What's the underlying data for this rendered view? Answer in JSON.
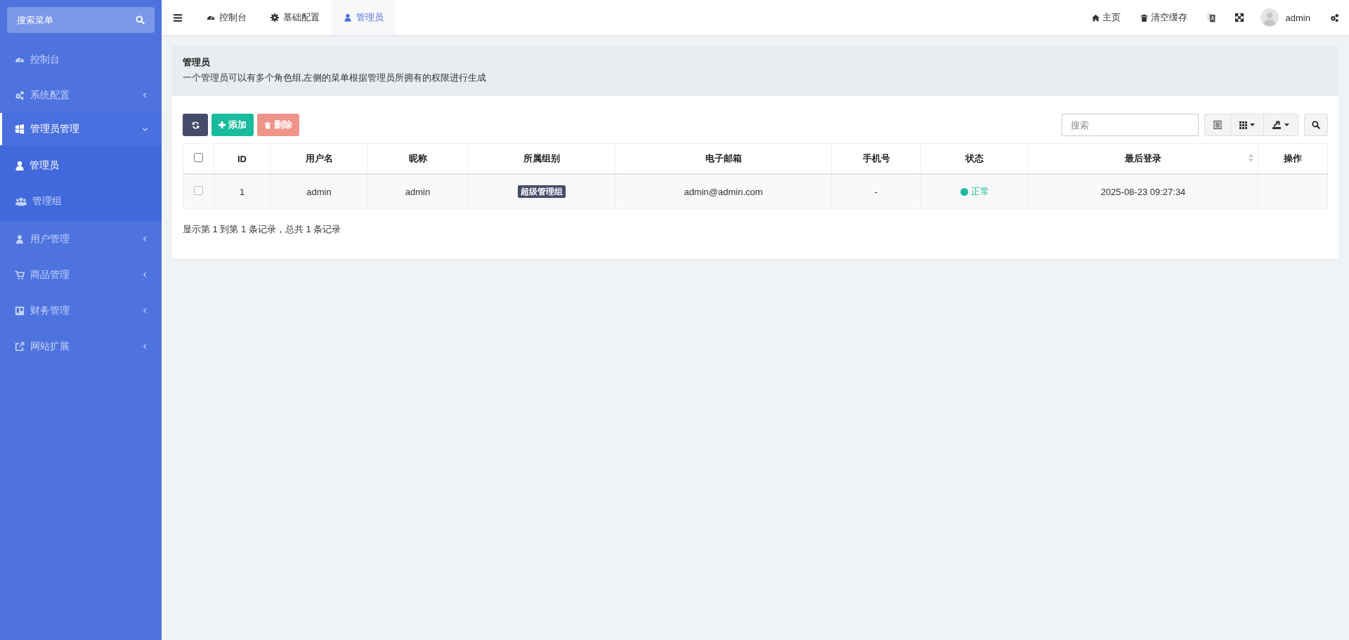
{
  "sidebar": {
    "search": {
      "placeholder": "搜索菜单"
    },
    "items": [
      {
        "label": "控制台",
        "selected": false
      },
      {
        "label": "系统配置",
        "selected": false,
        "expanded": false
      },
      {
        "label": "管理员管理",
        "selected": true,
        "expanded": true,
        "children": [
          {
            "label": "管理员",
            "selected": true
          },
          {
            "label": "管理组",
            "selected": false
          }
        ]
      },
      {
        "label": "用户管理",
        "selected": false,
        "expanded": false
      },
      {
        "label": "商品管理",
        "selected": false,
        "expanded": false
      },
      {
        "label": "财务管理",
        "selected": false,
        "expanded": false
      },
      {
        "label": "网站扩展",
        "selected": false,
        "expanded": false
      }
    ]
  },
  "tabs": [
    {
      "label": "控制台",
      "selected": false
    },
    {
      "label": "基础配置",
      "selected": false
    },
    {
      "label": "管理员",
      "selected": true
    }
  ],
  "header_actions": [
    {
      "label": "主页"
    },
    {
      "label": "清空缓存"
    }
  ],
  "user": {
    "name": "admin"
  },
  "page_header": {
    "title": "管理员",
    "description": "一个管理员可以有多个角色组,左侧的菜单根据管理员所拥有的权限进行生成"
  },
  "toolbar": {
    "buttons": [
      {
        "kind": "refresh",
        "disabled": false
      },
      {
        "kind": "add",
        "label": "添加",
        "disabled": false
      },
      {
        "kind": "delete",
        "label": "删除",
        "disabled": true
      }
    ],
    "search": {
      "placeholder": "搜索"
    }
  },
  "table": {
    "select_all": {
      "checked": false
    },
    "columns": [
      {
        "label": "ID",
        "sortable": false
      },
      {
        "label": "用户名",
        "sortable": false
      },
      {
        "label": "昵称",
        "sortable": false
      },
      {
        "label": "所属组别",
        "sortable": false
      },
      {
        "label": "电子邮箱",
        "sortable": false
      },
      {
        "label": "手机号",
        "sortable": false
      },
      {
        "label": "状态",
        "sortable": false
      },
      {
        "label": "最后登录",
        "sortable": true
      },
      {
        "label": "操作",
        "sortable": false
      }
    ],
    "rows": [
      {
        "checked": false,
        "id": "1",
        "username": "admin",
        "nickname": "admin",
        "group": "超级管理组",
        "email": "admin@admin.com",
        "phone": "-",
        "status": {
          "label": "正常",
          "color": "#18bc9c"
        },
        "last_login": "2025-08-23 09:27:34"
      }
    ]
  },
  "pagination_info": "显示第 1 到第 1 条记录，总共 1 条记录"
}
